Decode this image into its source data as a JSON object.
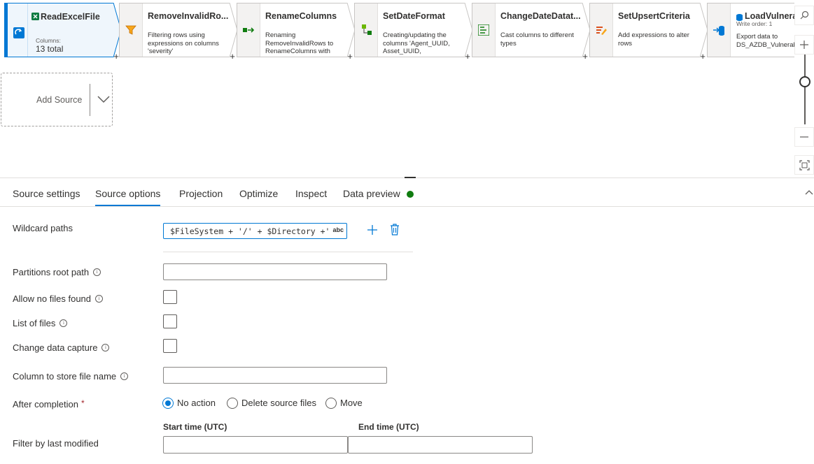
{
  "pipeline": {
    "nodes": [
      {
        "title": "ReadExcelFile",
        "sub_label": "Columns:",
        "sub_value": "13 total"
      },
      {
        "title": "RemoveInvalidRo...",
        "desc": "Filtering rows using expressions on columns 'severity'"
      },
      {
        "title": "RenameColumns",
        "desc": "Renaming RemoveInvalidRows to RenameColumns with"
      },
      {
        "title": "SetDateFormat",
        "desc": "Creating/updating the columns 'Agent_UUID, Asset_UUID,"
      },
      {
        "title": "ChangeDateDatat...",
        "desc": "Cast columns to different types"
      },
      {
        "title": "SetUpsertCriteria",
        "desc": "Add expressions to alter rows"
      },
      {
        "title": "LoadVulnerabili...",
        "write_order": "Write order: 1",
        "desc": "Export data to DS_AZDB_Vulnerabilities"
      }
    ],
    "add_source_label": "Add Source",
    "add_symbol": "+"
  },
  "tabs": [
    {
      "label": "Source settings"
    },
    {
      "label": "Source options"
    },
    {
      "label": "Projection"
    },
    {
      "label": "Optimize"
    },
    {
      "label": "Inspect"
    },
    {
      "label": "Data preview"
    }
  ],
  "form": {
    "wildcard_paths_label": "Wildcard paths",
    "wildcard_value": "$FileSystem + '/' + $Directory +'/'+ $...",
    "wildcard_badge": "abc",
    "partitions_root_label": "Partitions root path",
    "allow_no_files_label": "Allow no files found",
    "list_of_files_label": "List of files",
    "cdc_label": "Change data capture",
    "column_file_name_label": "Column to store file name",
    "after_completion_label": "After completion",
    "required_mark": "*",
    "info_glyph": "i",
    "radio_options": [
      "No action",
      "Delete source files",
      "Move"
    ],
    "radio_selected": "No action",
    "filter_label": "Filter by last modified",
    "start_time_label": "Start time (UTC)",
    "end_time_label": "End time (UTC)"
  },
  "colors": {
    "accent": "#0078d4",
    "status_ok": "#107c10"
  }
}
